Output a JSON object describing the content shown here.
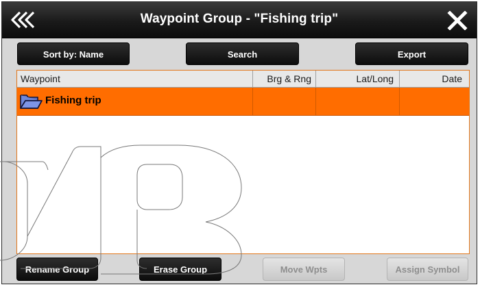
{
  "window": {
    "title": "Waypoint Group - \"Fishing trip\"",
    "back_icon": "double-chevron-left-icon",
    "close_icon": "close-icon"
  },
  "toolbar": {
    "sort_label": "Sort by: Name",
    "search_label": "Search",
    "export_label": "Export"
  },
  "table": {
    "columns": [
      "Waypoint",
      "Brg & Rng",
      "Lat/Long",
      "Date"
    ],
    "rows": [
      {
        "icon": "folder-icon",
        "name": "Fishing trip",
        "brg_rng": "",
        "lat_long": "",
        "date": "",
        "selected": true
      }
    ]
  },
  "actions": {
    "rename_label": "Rename Group",
    "erase_label": "Erase Group",
    "move_label": "Move Wpts",
    "assign_label": "Assign Symbol",
    "move_enabled": false,
    "assign_enabled": false
  },
  "colors": {
    "selection": "#ff6d00",
    "panel_border": "#e1761b",
    "titlebar": "#1a1a1a",
    "frame_bg": "#d7d7d7"
  }
}
